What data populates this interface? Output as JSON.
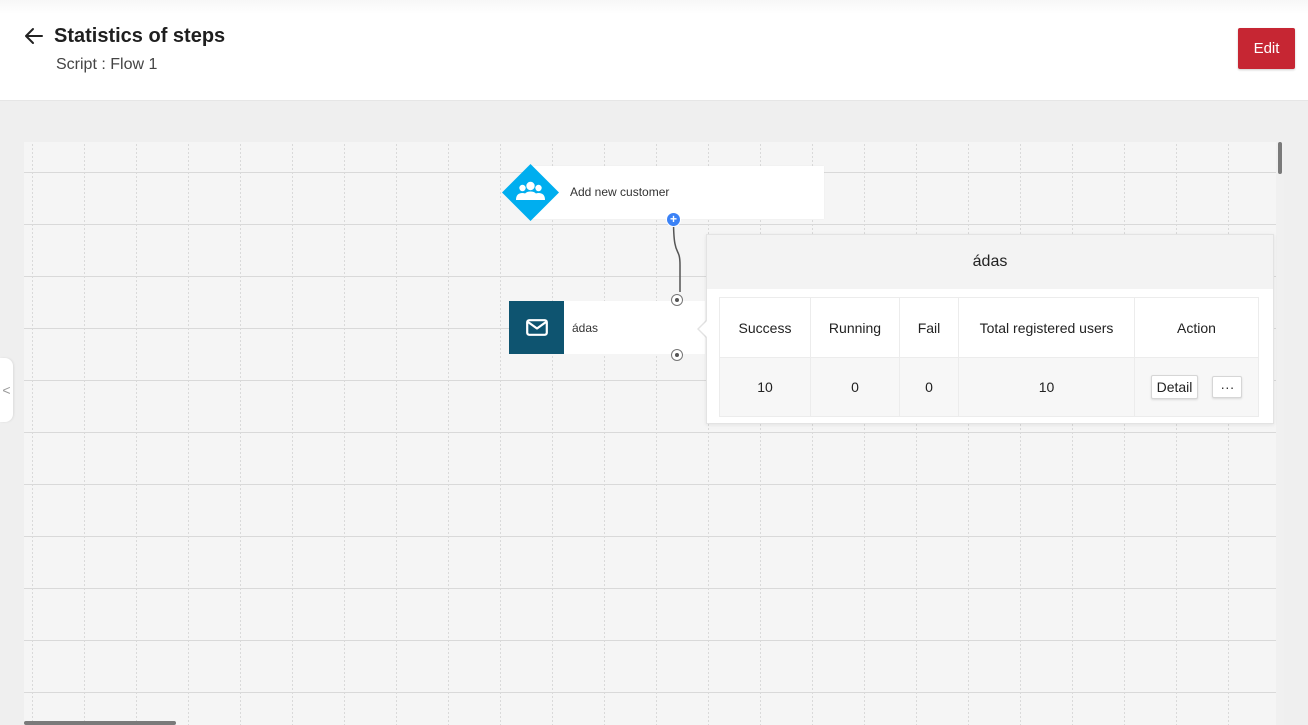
{
  "header": {
    "title": "Statistics of steps",
    "subtitle": "Script : Flow 1",
    "edit_label": "Edit",
    "accent_color": "#c62633"
  },
  "flow": {
    "trigger_node": {
      "label": "Add new customer",
      "icon": "users-group-icon",
      "color": "#00aeef"
    },
    "email_node": {
      "label": "ádas",
      "icon": "envelope-icon",
      "color": "#0e5470"
    }
  },
  "stats_popover": {
    "title": "ádas",
    "columns": [
      "Success",
      "Running",
      "Fail",
      "Total registered users",
      "Action"
    ],
    "row": {
      "success": "10",
      "running": "0",
      "fail": "0",
      "total": "10",
      "detail_label": "Detail",
      "more_label": "···"
    }
  },
  "sidebar": {
    "collapse_glyph": "<"
  }
}
